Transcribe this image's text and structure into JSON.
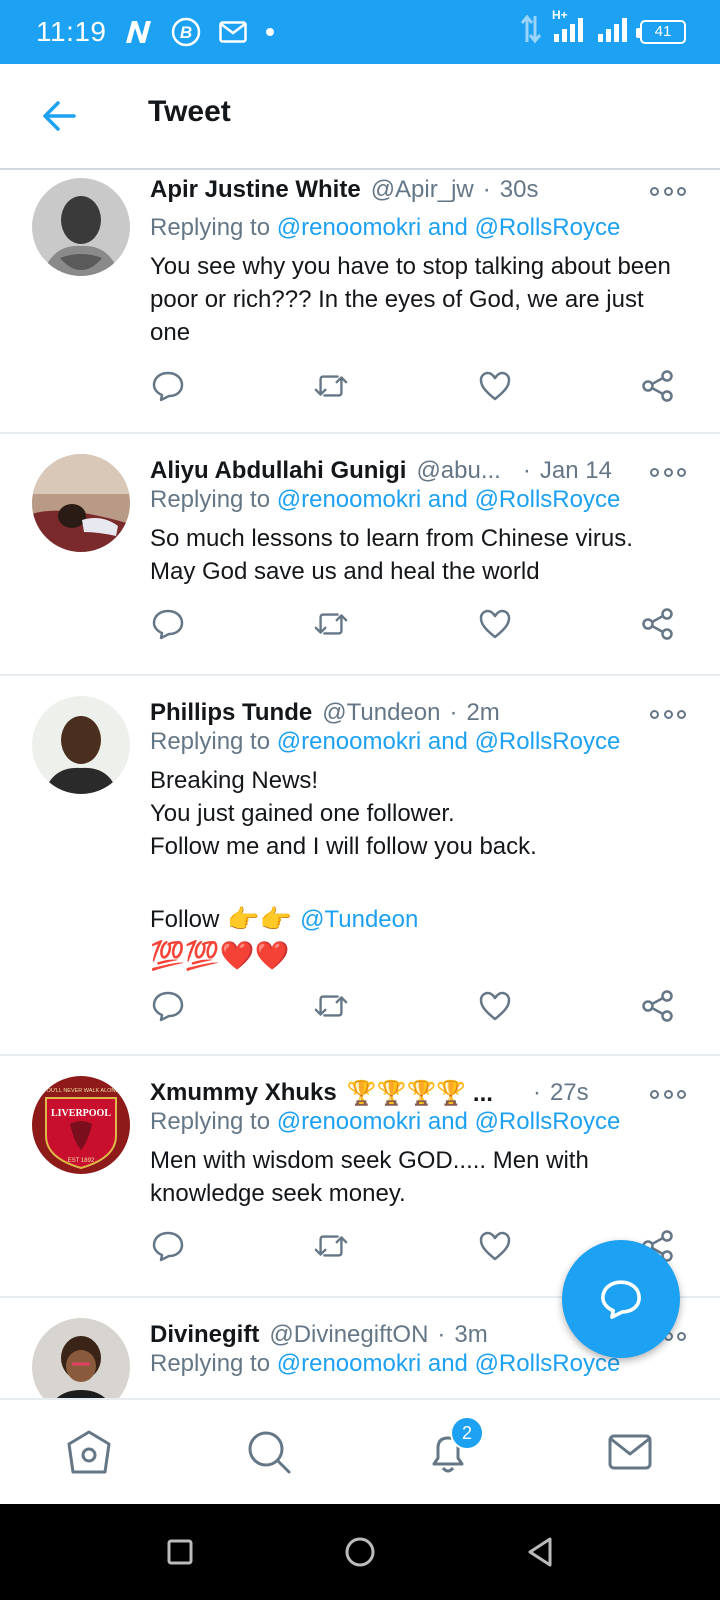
{
  "status_bar": {
    "time": "11:19",
    "network": "H+",
    "battery": "41",
    "bg_color": "#1da1f2"
  },
  "header": {
    "title": "Tweet",
    "back_icon": "arrow-left-icon"
  },
  "colors": {
    "accent": "#1da1f2",
    "text": "#14171a",
    "secondary": "#657786"
  },
  "replying_prefix": "Replying to",
  "mention_a": "@renoomokri",
  "mention_join": "and",
  "mention_b": "@RollsRoyce",
  "tweets": [
    {
      "name": "Apir Justine White",
      "handle": "@Apir_jw",
      "time": "30s",
      "body": "You see why you have to stop talking about been poor or rich??? In the eyes of God, we are just one"
    },
    {
      "name": "Aliyu Abdullahi Gunigi",
      "handle": "@abu...",
      "time": "Jan 14",
      "body": "So much lessons to learn from Chinese virus. May God save us and heal the world"
    },
    {
      "name": "Phillips Tunde",
      "handle": "@Tundeon",
      "time": "2m",
      "body_lines": [
        "Breaking News!",
        "You just gained one follower.",
        "Follow me and I will follow you back."
      ],
      "follow_word": "Follow",
      "follow_emoji": "👉👉",
      "follow_mention": "@Tundeon",
      "emoji_line": "💯💯❤️❤️"
    },
    {
      "name": "Xmummy Xhuks",
      "name_emoji": "🏆🏆🏆🏆 ...",
      "handle": "",
      "time": "27s",
      "avatar_text_top": "YOU'LL NEVER WALK ALONE",
      "avatar_text_main": "LIVERPOOL",
      "avatar_text_bottom": "EST 1892",
      "body": "Men with wisdom seek GOD..... Men with knowledge seek money."
    },
    {
      "name": "Divinegift",
      "handle": "@DivinegiftON",
      "time": "3m"
    }
  ],
  "bottom_nav": {
    "notification_count": "2",
    "items": [
      "home-icon",
      "search-icon",
      "bell-icon",
      "mail-icon"
    ]
  }
}
